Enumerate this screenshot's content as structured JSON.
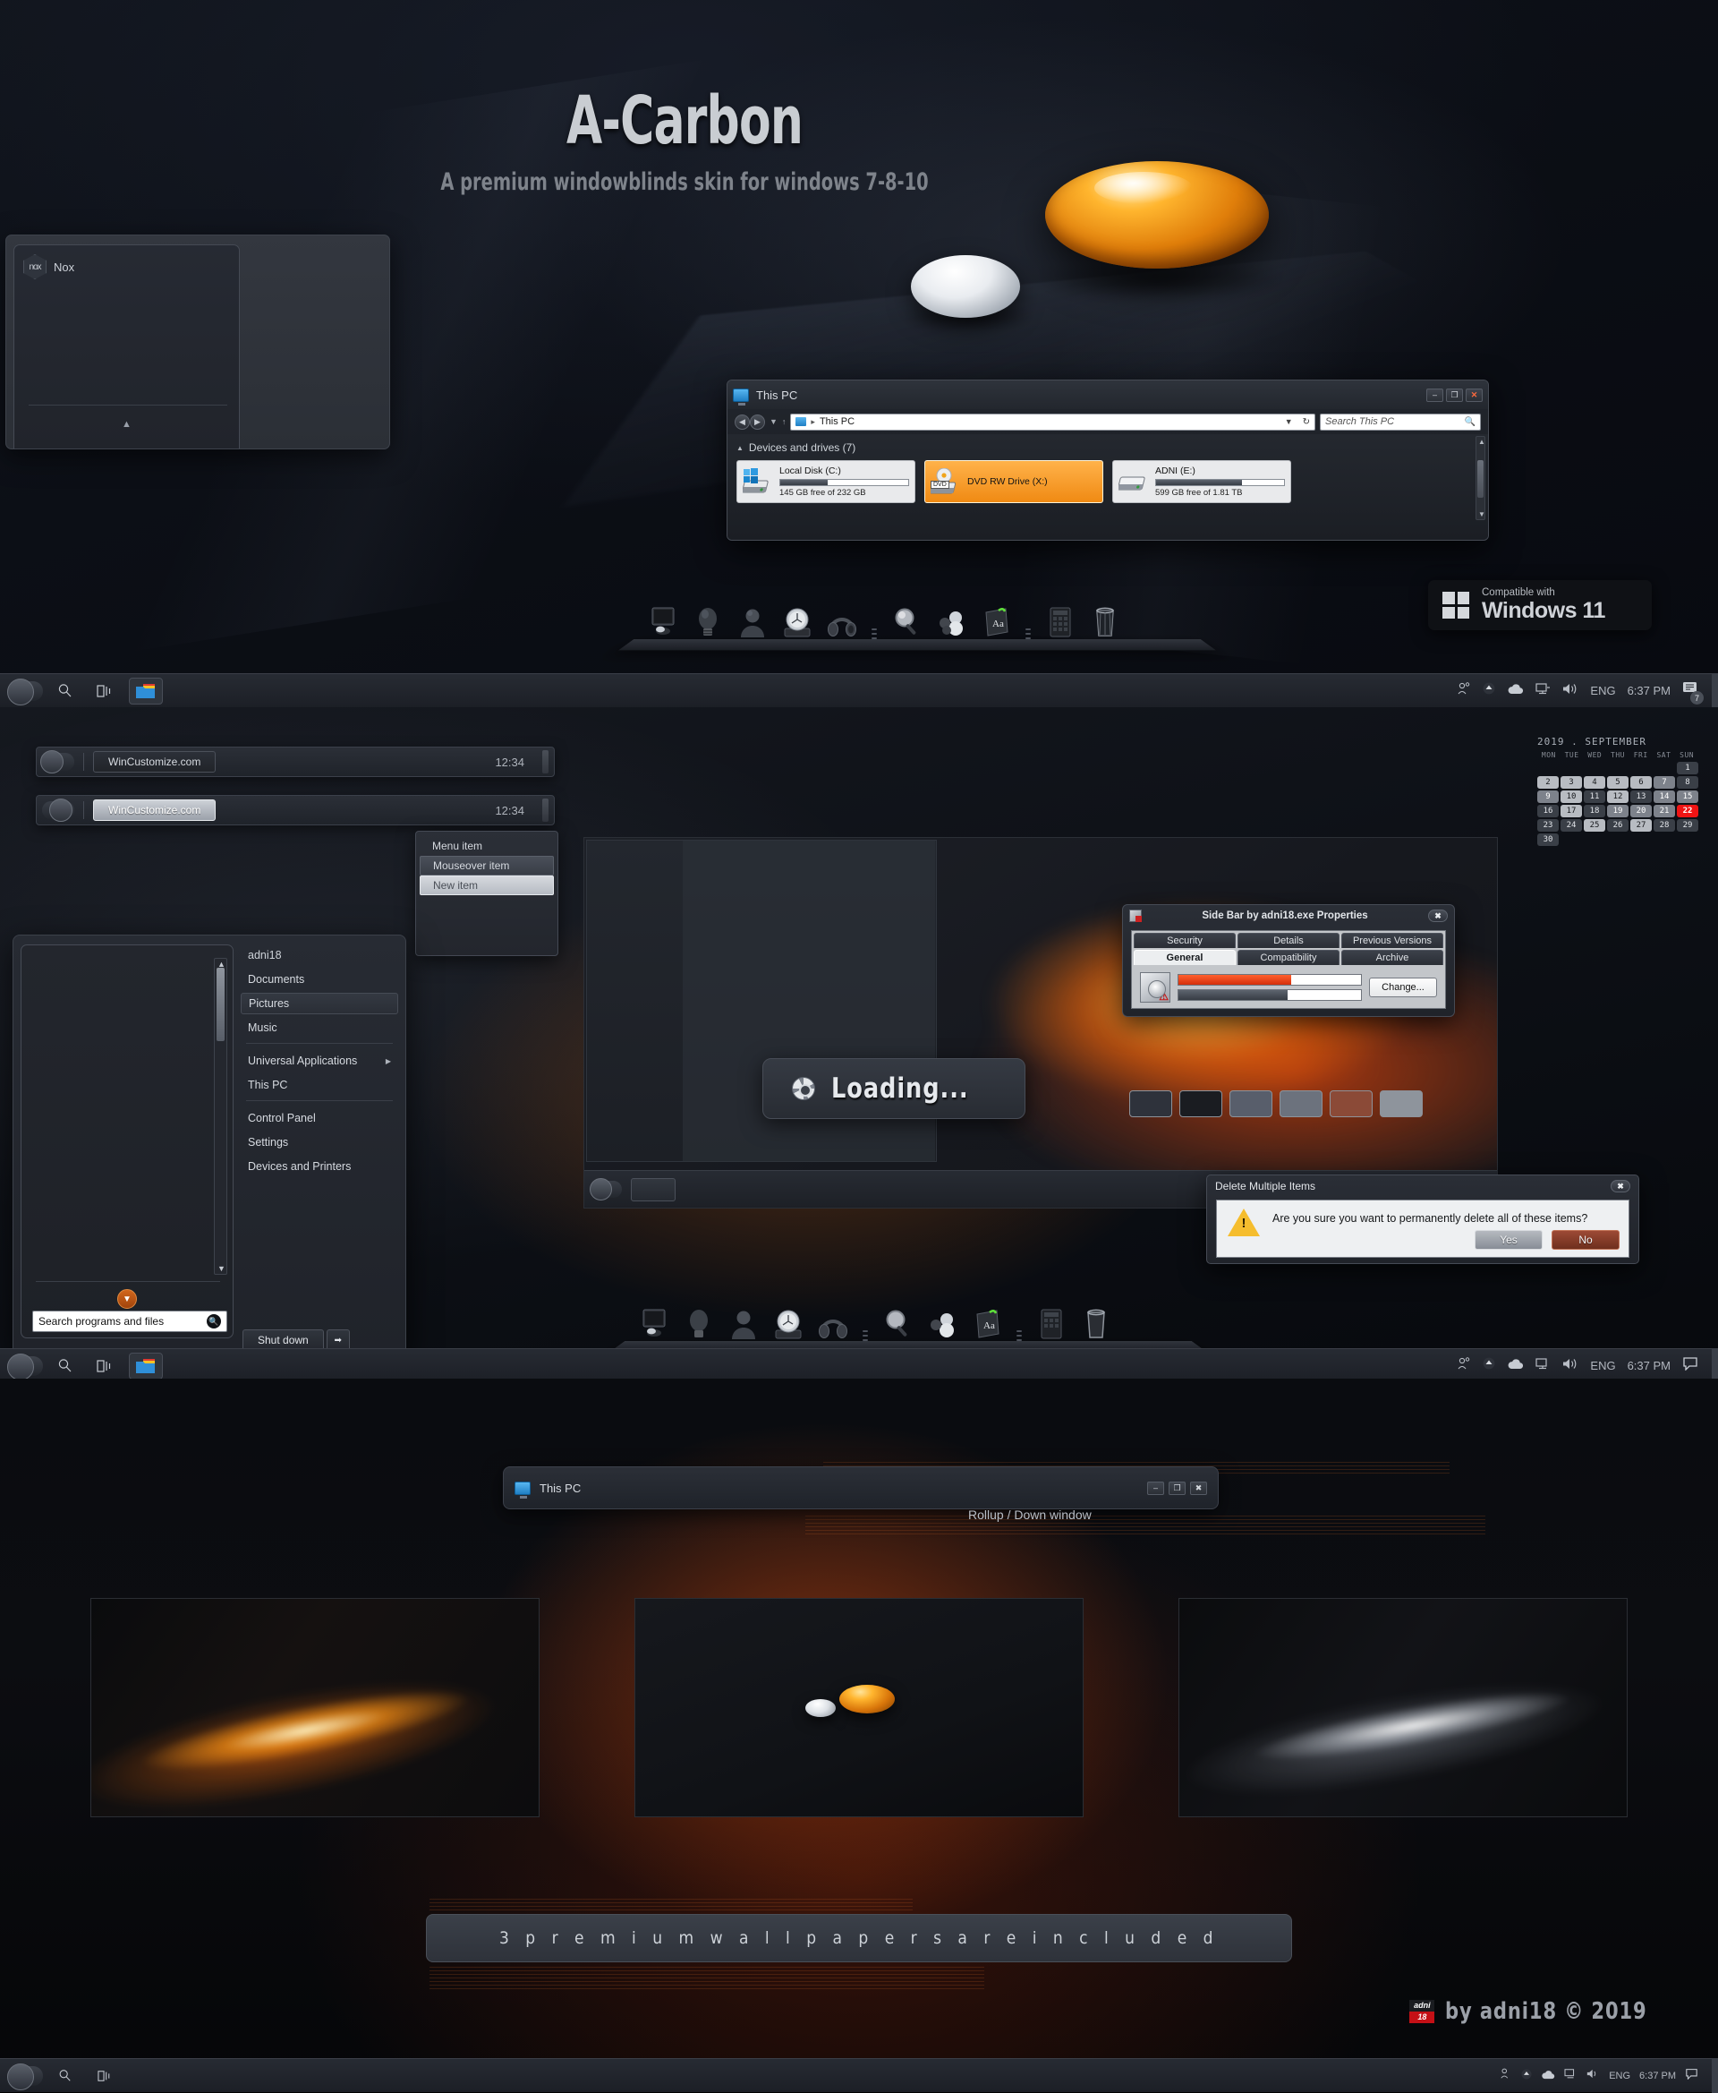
{
  "hero": {
    "title": "A-Carbon",
    "subtitle": "A premium windowblinds skin for windows 7-8-10"
  },
  "nox_window": {
    "title": "Nox",
    "logo_text": "nox"
  },
  "explorer": {
    "title": "This PC",
    "address": "This PC",
    "search_placeholder": "Search This PC",
    "group_header": "Devices and drives (7)",
    "minimize": "–",
    "maximize": "❐",
    "close": "✕",
    "drives": [
      {
        "name": "Local Disk (C:)",
        "free": "145 GB free of 232 GB",
        "used_pct": 37,
        "selected": false,
        "icon": "windows-drive-icon"
      },
      {
        "name": "DVD RW Drive (X:)",
        "free": "",
        "used_pct": 0,
        "selected": true,
        "icon": "dvd-drive-icon",
        "tag": "DVD"
      },
      {
        "name": "ADNI (E:)",
        "free": "599 GB free of 1.81 TB",
        "used_pct": 67,
        "selected": false,
        "icon": "hard-drive-icon"
      }
    ]
  },
  "dock": {
    "icons": [
      "monitor-icon",
      "lightbulb-icon",
      "contact-bust-icon",
      "clock-icon",
      "headphones-icon",
      "magnifier-icon",
      "network-people-icon",
      "dictionary-icon",
      "calculator-icon",
      "trash-icon"
    ]
  },
  "win11_badge": {
    "small": "Compatible with",
    "big": "Windows 11"
  },
  "taskbar": {
    "start_label": "start-button",
    "search_icon": "search-icon",
    "taskview_icon": "task-view-icon",
    "explorer_icon": "file-explorer-icon",
    "tray": {
      "people": "people-icon",
      "show_hidden": "show-hidden-icons-icon",
      "onedrive": "onedrive-cloud-icon",
      "network": "network-icon",
      "volume": "volume-icon",
      "language": "ENG",
      "time": "6:37 PM",
      "notifications_icon": "action-center-icon",
      "notifications_count": "7"
    }
  },
  "taskbar_previews": [
    {
      "label": "WinCustomize.com",
      "time": "12:34",
      "state": "normal"
    },
    {
      "label": "WinCustomize.com",
      "time": "12:34",
      "state": "hover"
    }
  ],
  "context_menu": {
    "items": [
      {
        "label": "Menu item",
        "state": "normal"
      },
      {
        "label": "Mouseover item",
        "state": "hover"
      },
      {
        "label": "New item",
        "state": "selected"
      }
    ]
  },
  "start_menu": {
    "search_placeholder": "Search programs and files",
    "search_icon": "search-icon",
    "expand_icon": "chevron-down-icon",
    "items": [
      {
        "label": "adni18",
        "selected": false,
        "submenu": false
      },
      {
        "label": "Documents",
        "selected": false,
        "submenu": false
      },
      {
        "label": "Pictures",
        "selected": true,
        "submenu": false
      },
      {
        "label": "Music",
        "selected": false,
        "submenu": false
      },
      {
        "label": "Universal Applications",
        "selected": false,
        "submenu": true
      },
      {
        "label": "This PC",
        "selected": false,
        "submenu": false
      },
      {
        "label": "Control Panel",
        "selected": false,
        "submenu": false
      },
      {
        "label": "Settings",
        "selected": false,
        "submenu": false
      },
      {
        "label": "Devices and Printers",
        "selected": false,
        "submenu": false
      }
    ],
    "shutdown_label": "Shut down",
    "shutdown_arrow": "➡"
  },
  "loading_dialog": {
    "label": "Loading...",
    "spinner_icon": "loading-spinner-icon"
  },
  "properties_dialog": {
    "title": "Side Bar by adni18.exe Properties",
    "close": "✖",
    "tabs_top": [
      "Security",
      "Details",
      "Previous Versions"
    ],
    "tabs_bottom": [
      "General",
      "Compatibility",
      "Archive"
    ],
    "active_tab": "General",
    "change_button": "Change...",
    "bar_red_pct": 62,
    "bar_gray_pct": 60
  },
  "swatches": [
    "#2e323b",
    "#1a1c21",
    "#585e6b",
    "#6c727d",
    "#8b4a37",
    "#8e949c"
  ],
  "delete_dialog": {
    "title": "Delete Multiple Items",
    "close": "✖",
    "message": "Are you sure you want to permanently delete all of these items?",
    "yes_label": "Yes",
    "no_label": "No",
    "warning_icon": "warning-triangle-icon",
    "warning_glyph": "!"
  },
  "calendar": {
    "header": "2019 . SEPTEMBER",
    "dow": [
      "MON",
      "TUE",
      "WED",
      "THU",
      "FRI",
      "SAT",
      "SUN"
    ],
    "today": "22",
    "cells": [
      {
        "n": "",
        "s": "e"
      },
      {
        "n": "",
        "s": "e"
      },
      {
        "n": "",
        "s": "e"
      },
      {
        "n": "",
        "s": "e"
      },
      {
        "n": "",
        "s": "e"
      },
      {
        "n": "",
        "s": "e"
      },
      {
        "n": "1",
        "s": "d"
      },
      {
        "n": "2",
        "s": "l"
      },
      {
        "n": "3",
        "s": "l"
      },
      {
        "n": "4",
        "s": "l"
      },
      {
        "n": "5",
        "s": "l"
      },
      {
        "n": "6",
        "s": "l"
      },
      {
        "n": "7",
        "s": "m"
      },
      {
        "n": "8",
        "s": "d"
      },
      {
        "n": "9",
        "s": "m"
      },
      {
        "n": "10",
        "s": "l"
      },
      {
        "n": "11",
        "s": "d"
      },
      {
        "n": "12",
        "s": "l"
      },
      {
        "n": "13",
        "s": "d"
      },
      {
        "n": "14",
        "s": "m"
      },
      {
        "n": "15",
        "s": "m"
      },
      {
        "n": "16",
        "s": "d"
      },
      {
        "n": "17",
        "s": "l"
      },
      {
        "n": "18",
        "s": "d"
      },
      {
        "n": "19",
        "s": "m"
      },
      {
        "n": "20",
        "s": "m"
      },
      {
        "n": "21",
        "s": "m"
      },
      {
        "n": "22",
        "s": "today"
      },
      {
        "n": "23",
        "s": "d"
      },
      {
        "n": "24",
        "s": "d"
      },
      {
        "n": "25",
        "s": "l"
      },
      {
        "n": "26",
        "s": "d"
      },
      {
        "n": "27",
        "s": "l"
      },
      {
        "n": "28",
        "s": "d"
      },
      {
        "n": "29",
        "s": "d"
      },
      {
        "n": "30",
        "s": "d"
      },
      {
        "n": "",
        "s": "e"
      },
      {
        "n": "",
        "s": "e"
      },
      {
        "n": "",
        "s": "e"
      },
      {
        "n": "",
        "s": "e"
      },
      {
        "n": "",
        "s": "e"
      },
      {
        "n": "",
        "s": "e"
      }
    ]
  },
  "rollup_window": {
    "title": "This PC",
    "caption": "Rollup / Down window",
    "minimize": "–",
    "maximize": "❐",
    "close": "✖"
  },
  "wallpapers": {
    "note": "3  p r e m i u m   w a l l p a p e r s   a r e   i n c l u d e d",
    "count": 3
  },
  "credit": {
    "logo_top": "adni",
    "logo_bottom": "18",
    "text": "by adni18 © 2019"
  }
}
